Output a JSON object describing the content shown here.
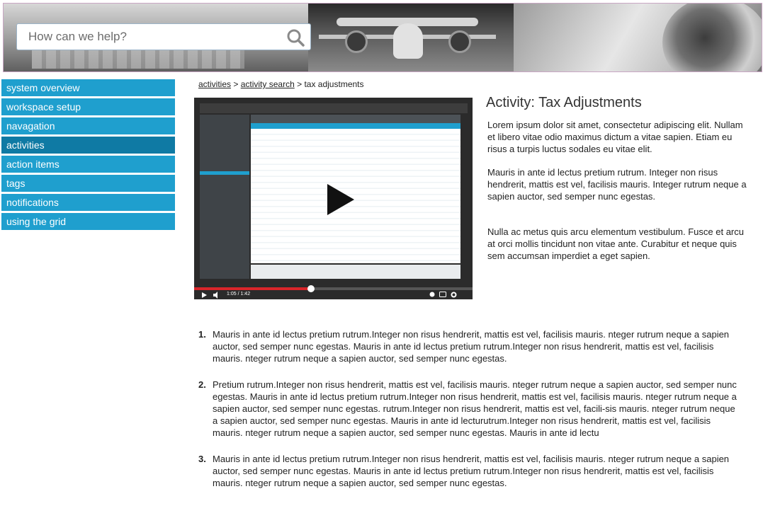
{
  "search": {
    "placeholder": "How can we help?"
  },
  "sidebar": {
    "items": [
      {
        "label": "system overview",
        "active": false
      },
      {
        "label": "workspace setup",
        "active": false
      },
      {
        "label": "navagation",
        "active": false
      },
      {
        "label": "activities",
        "active": true
      },
      {
        "label": "action items",
        "active": false
      },
      {
        "label": "tags",
        "active": false
      },
      {
        "label": "notifications",
        "active": false
      },
      {
        "label": "using the grid",
        "active": false
      }
    ]
  },
  "breadcrumb": {
    "links": [
      "activities",
      "activity search"
    ],
    "separator": ">",
    "current": "tax adjustments"
  },
  "video": {
    "time": "1:05 / 1:42",
    "progress": 0.42
  },
  "activity": {
    "title": "Activity: Tax Adjustments",
    "paragraphs": [
      "Lorem ipsum dolor sit amet, consectetur adipiscing elit. Nullam et libero vitae odio maximus dictum a vitae sapien. Etiam eu risus a turpis luctus sodales eu vitae elit.",
      "Mauris in ante id lectus pretium rutrum. Integer non risus hendrerit, mattis est vel, facilisis mauris. Integer rutrum neque a sapien auctor, sed semper nunc egestas.",
      "Nulla ac metus quis arcu elementum vestibulum. Fusce et arcu at orci mollis tincidunt non vitae ante. Curabitur et neque quis sem accumsan imperdiet a eget sapien."
    ]
  },
  "steps": [
    {
      "num": "1.",
      "text": "Mauris in ante id lectus pretium rutrum.Integer non risus hendrerit, mattis est vel, facilisis mauris. nteger rutrum neque a sapien auctor, sed semper nunc egestas. Mauris in ante id lectus pretium rutrum.Integer non risus hendrerit, mattis est vel, facilisis mauris. nteger rutrum neque a sapien auctor, sed semper nunc egestas."
    },
    {
      "num": "2.",
      "text": "Pretium rutrum.Integer non risus hendrerit, mattis est vel, facilisis mauris. nteger rutrum neque a sapien auctor, sed semper nunc egestas. Mauris in ante id lectus pretium rutrum.Integer non risus hendrerit, mattis est vel, facilisis mauris. nteger rutrum neque a sapien auctor, sed semper nunc egestas. rutrum.Integer non risus hendrerit, mattis est vel, facili-sis mauris. nteger rutrum neque a sapien auctor, sed semper nunc egestas. Mauris in ante id lecturutrum.Integer non risus hendrerit, mattis est vel, facilisis mauris. nteger rutrum neque a sapien auctor, sed semper nunc egestas. Mauris in ante id lectu"
    },
    {
      "num": "3.",
      "text": "Mauris in ante id lectus pretium rutrum.Integer non risus hendrerit, mattis est vel, facilisis mauris. nteger rutrum neque a sapien auctor, sed semper nunc egestas. Mauris in ante id lectus pretium rutrum.Integer non risus hendrerit, mattis est vel, facilisis mauris. nteger rutrum neque a sapien auctor, sed semper nunc egestas."
    }
  ],
  "colors": {
    "nav": "#1f9fce",
    "nav_active": "#0f7aa4",
    "progress": "#d9252a"
  },
  "icons": {
    "search": "magnifier-icon",
    "play": "play-icon"
  }
}
